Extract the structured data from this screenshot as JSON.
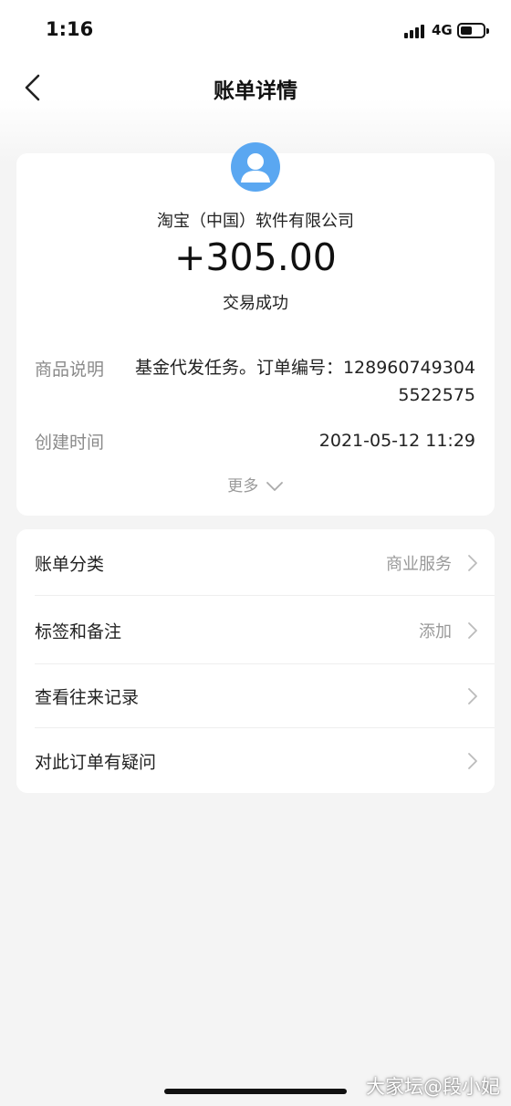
{
  "status_bar": {
    "time": "1:16",
    "network": "4G",
    "battery_level": 0.4
  },
  "nav": {
    "title": "账单详情",
    "back_icon": "chevron-left-icon"
  },
  "detail": {
    "avatar_icon": "user-avatar-icon",
    "merchant": "淘宝（中国）软件有限公司",
    "amount": "+305.00",
    "status": "交易成功",
    "rows": [
      {
        "label": "商品说明",
        "value": "基金代发任务。订单编号：1289607493045522575"
      },
      {
        "label": "创建时间",
        "value": "2021-05-12 11:29"
      }
    ],
    "more_label": "更多",
    "more_icon": "chevron-down-icon"
  },
  "menu": [
    {
      "label": "账单分类",
      "value": "商业服务"
    },
    {
      "label": "标签和备注",
      "value": "添加"
    },
    {
      "label": "查看往来记录",
      "value": ""
    },
    {
      "label": "对此订单有疑问",
      "value": ""
    }
  ],
  "watermark": "大家坛@段小妃"
}
